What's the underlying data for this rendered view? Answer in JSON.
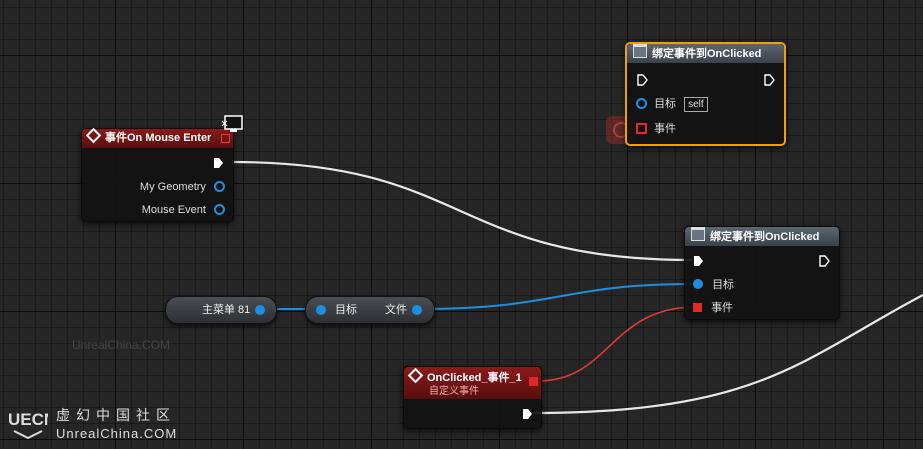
{
  "nodes": {
    "mouse_enter": {
      "title": "事件On Mouse Enter",
      "pins": {
        "geometry": "My Geometry",
        "mouse_event": "Mouse Event"
      }
    },
    "bind_top": {
      "title": "绑定事件到OnClicked",
      "target_label": "目标",
      "target_value": "self",
      "event_label": "事件"
    },
    "bind_main": {
      "title": "绑定事件到OnClicked",
      "target_label": "目标",
      "event_label": "事件"
    },
    "main_menu": {
      "label": "主菜单 81"
    },
    "file_getter": {
      "target_label": "目标",
      "output_label": "文件"
    },
    "custom_event": {
      "title": "OnClicked_事件_1",
      "subtitle": "自定义事件"
    }
  },
  "watermark": {
    "center": "UnrealChina.COM"
  },
  "brand": {
    "logo": "UECN",
    "name_cn": "虚幻中国社区",
    "name_en": "UnrealChina.COM"
  },
  "colors": {
    "exec_wire": "#e8e8e8",
    "object_wire": "#1d8fe0",
    "delegate_wire": "#e03a3a",
    "selection": "#f0a000"
  }
}
